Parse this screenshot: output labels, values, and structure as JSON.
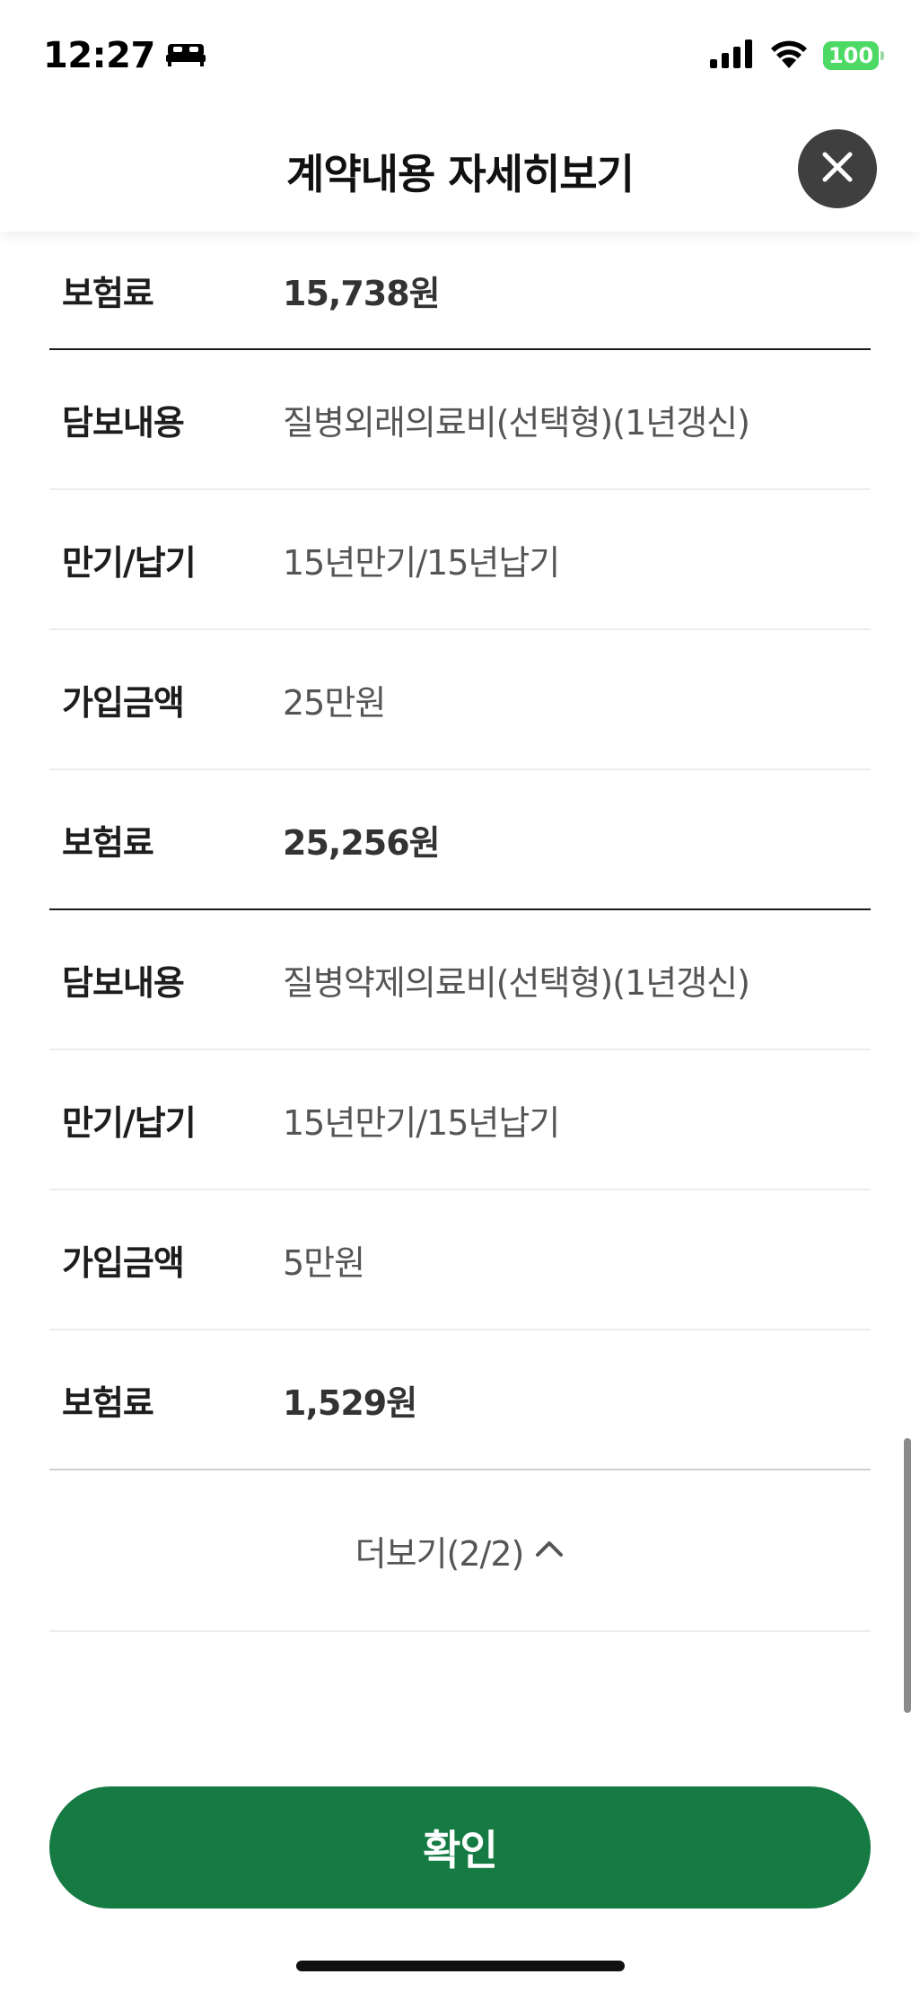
{
  "status": {
    "time": "12:27",
    "battery": "100"
  },
  "header": {
    "title": "계약내용 자세히보기"
  },
  "rows": [
    {
      "label": "보험료",
      "value": "15,738원"
    },
    {
      "label": "담보내용",
      "value": "질병외래의료비(선택형)(1년갱신)"
    },
    {
      "label": "만기/납기",
      "value": "15년만기/15년납기"
    },
    {
      "label": "가입금액",
      "value": "25만원"
    },
    {
      "label": "보험료",
      "value": "25,256원"
    },
    {
      "label": "담보내용",
      "value": "질병약제의료비(선택형)(1년갱신)"
    },
    {
      "label": "만기/납기",
      "value": "15년만기/15년납기"
    },
    {
      "label": "가입금액",
      "value": "5만원"
    },
    {
      "label": "보험료",
      "value": "1,529원"
    }
  ],
  "more": {
    "label": "더보기(2/2)"
  },
  "confirm": {
    "label": "확인"
  },
  "colors": {
    "accent": "#167a43",
    "battery": "#4cd964",
    "close_bg": "#3f3f3f"
  }
}
